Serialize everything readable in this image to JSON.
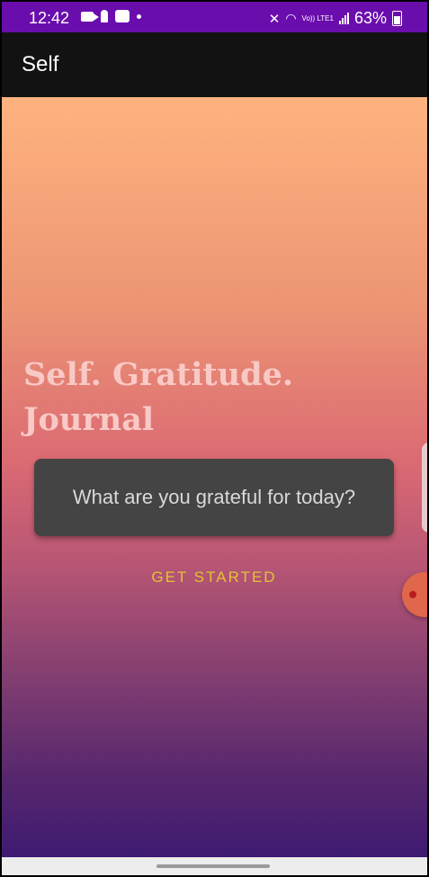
{
  "status_bar": {
    "time": "12:42",
    "battery": "63%",
    "volte_label": "Vo)) LTE1",
    "icons": [
      "video-camera-icon",
      "keyhole-icon",
      "teams-icon",
      "notification-dot-icon",
      "mute-icon",
      "wifi-icon",
      "volte-icon",
      "signal-icon",
      "battery-icon"
    ]
  },
  "app_bar": {
    "title": "Self"
  },
  "main": {
    "headline": "Self. Gratitude. Journal",
    "prompt": "What are you grateful for today?",
    "cta_label": "GET STARTED"
  },
  "colors": {
    "status_bar": "#6a0dad",
    "app_bar": "#121212",
    "gradient_top": "#ffb37e",
    "gradient_bottom": "#3f1a72",
    "headline": "#f9c9c6",
    "card": "#444444",
    "cta": "#e3c232"
  }
}
